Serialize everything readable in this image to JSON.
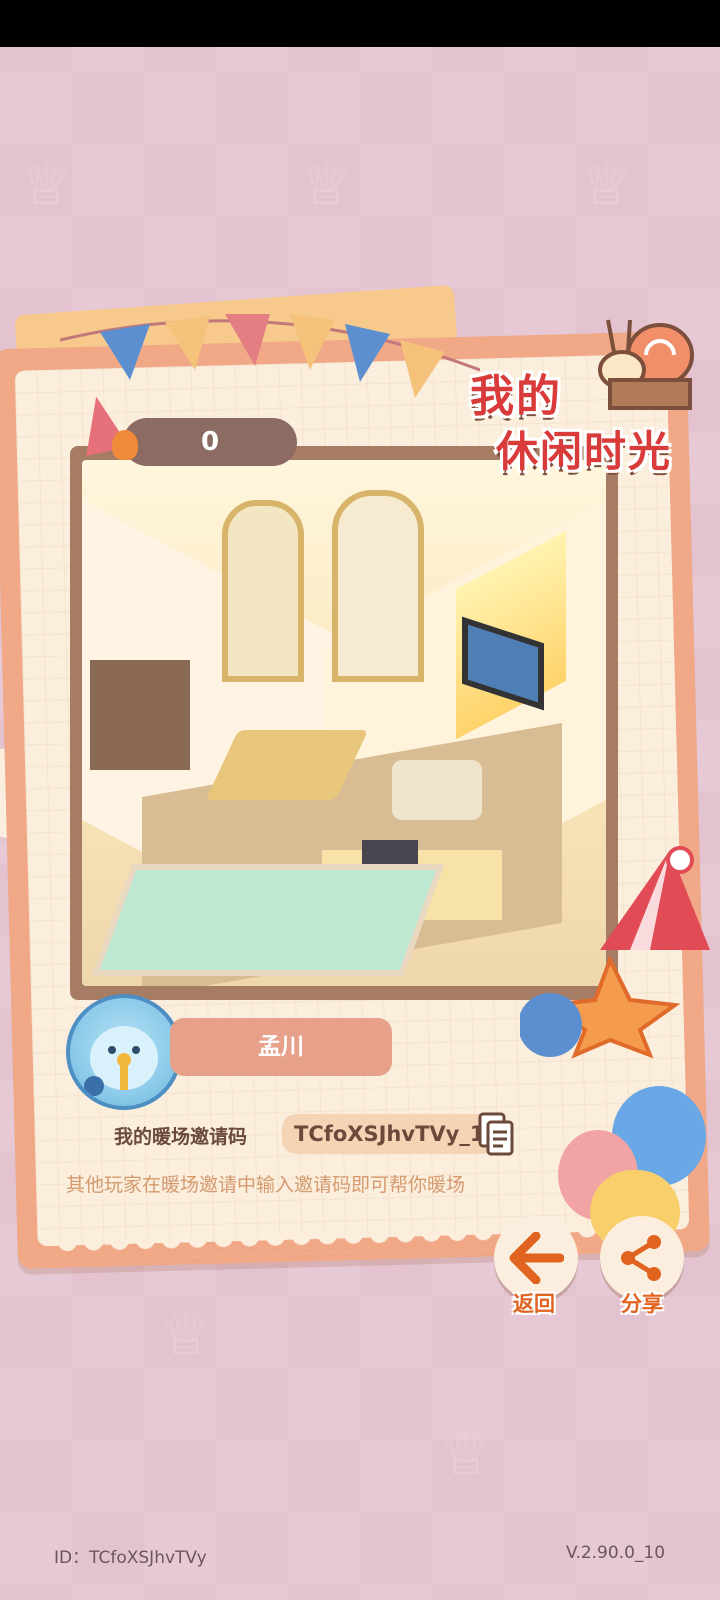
{
  "hud": {
    "score": "0"
  },
  "title": {
    "line1": "我的",
    "line2": "休闲时光"
  },
  "profile": {
    "name": "孟川",
    "invite_label": "我的暖场邀请码",
    "invite_code": "TCfoXSJhvTVy_1",
    "invite_hint": "其他玩家在暖场邀请中输入邀请码即可帮你暖场"
  },
  "actions": {
    "back_label": "返回",
    "share_label": "分享"
  },
  "footer": {
    "id_text": "ID：TCfoXSJhvTVy",
    "version": "V.2.90.0_10"
  },
  "colors": {
    "accent": "#e0641f",
    "name_pill": "#e7a08a",
    "card": "#f1a887"
  }
}
